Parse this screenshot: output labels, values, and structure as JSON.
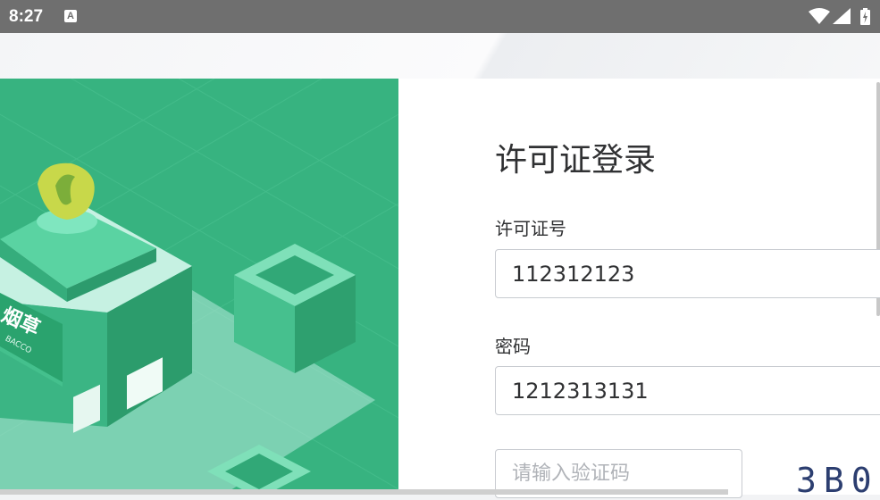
{
  "status_bar": {
    "time": "8:27",
    "notification_icon": "A"
  },
  "login": {
    "title": "许可证登录",
    "license_label": "许可证号",
    "license_value": "112312123",
    "password_label": "密码",
    "password_value": "1212313131",
    "captcha_placeholder": "请输入验证码",
    "captcha_text": "3B0"
  },
  "illustration": {
    "sign_text": "烟草",
    "sign_subtext": "BACCO"
  },
  "colors": {
    "illustration_green": "#37b380",
    "status_bar": "#6f6f6f"
  },
  "icons": [
    "wifi-icon",
    "signal-icon",
    "battery-icon",
    "notification-icon"
  ]
}
